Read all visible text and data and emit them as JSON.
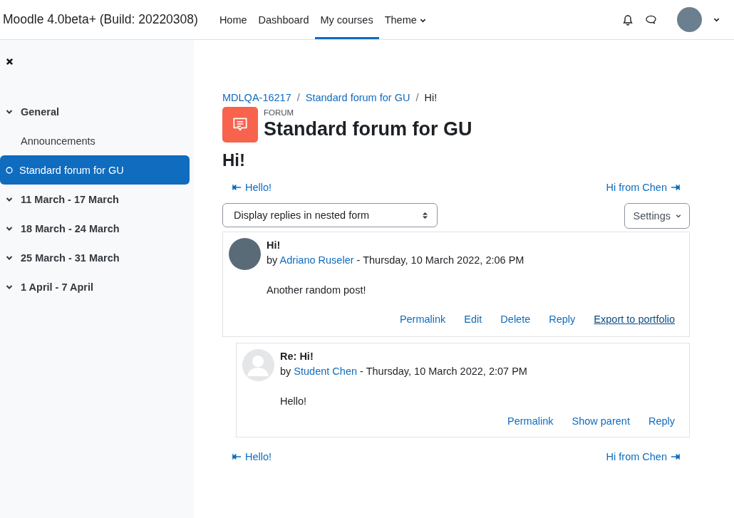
{
  "navbar": {
    "site_name": "Moodle 4.0beta+ (Build: 20220308)",
    "items": [
      {
        "label": "Home",
        "selected": false,
        "kind": "link"
      },
      {
        "label": "Dashboard",
        "selected": false,
        "kind": "link"
      },
      {
        "label": "My courses",
        "selected": true,
        "kind": "link"
      },
      {
        "label": "Theme",
        "selected": false,
        "kind": "dropdown"
      }
    ]
  },
  "sidebar": {
    "sections": [
      {
        "label": "General",
        "expanded": true,
        "children": [
          {
            "label": "Announcements",
            "selected": false
          },
          {
            "label": "Standard forum for GU",
            "selected": true
          }
        ]
      },
      {
        "label": "11 March - 17 March",
        "expanded": true
      },
      {
        "label": "18 March - 24 March",
        "expanded": true
      },
      {
        "label": "25 March - 31 March",
        "expanded": true
      },
      {
        "label": "1 April - 7 April",
        "expanded": true
      }
    ]
  },
  "breadcrumb": [
    {
      "label": "MDLQA-16217",
      "kind": "link"
    },
    {
      "separator": "/",
      "kind": "separator"
    },
    {
      "label": "Standard forum for GU",
      "kind": "link"
    },
    {
      "separator": "/",
      "kind": "separator"
    },
    {
      "label": "Hi!",
      "kind": "current"
    }
  ],
  "activity": {
    "type_label": "FORUM",
    "title": "Standard forum for GU"
  },
  "discussion_title": "Hi!",
  "top_nav": {
    "prev": "Hello!",
    "next": "Hi from Chen"
  },
  "display_select": {
    "value": "Display replies in nested form"
  },
  "settings_button": "Settings",
  "posts": [
    {
      "subject": "Hi!",
      "by": "by",
      "author": "Adriano Ruseler",
      "date": "- Thursday, 10 March 2022, 2:06 PM",
      "avatar": {
        "kind": "photo"
      },
      "body": "Another random post!",
      "reply": false,
      "actions": [
        {
          "label": "Permalink",
          "hovered": false
        },
        {
          "label": "Edit",
          "hovered": false
        },
        {
          "label": "Delete",
          "hovered": false
        },
        {
          "label": "Reply",
          "hovered": false
        },
        {
          "label": "Export to portfolio",
          "hovered": true
        }
      ]
    },
    {
      "subject": "Re: Hi!",
      "by": "by",
      "author": "Student Chen",
      "date": "- Thursday, 10 March 2022, 2:07 PM",
      "avatar": {
        "kind": "default"
      },
      "body": "Hello!",
      "reply": true,
      "actions": [
        {
          "label": "Permalink",
          "hovered": false
        },
        {
          "label": "Show parent",
          "hovered": false
        },
        {
          "label": "Reply",
          "hovered": false
        }
      ]
    }
  ],
  "bottom_nav": {
    "prev": "Hello!",
    "next": "Hi from Chen"
  }
}
